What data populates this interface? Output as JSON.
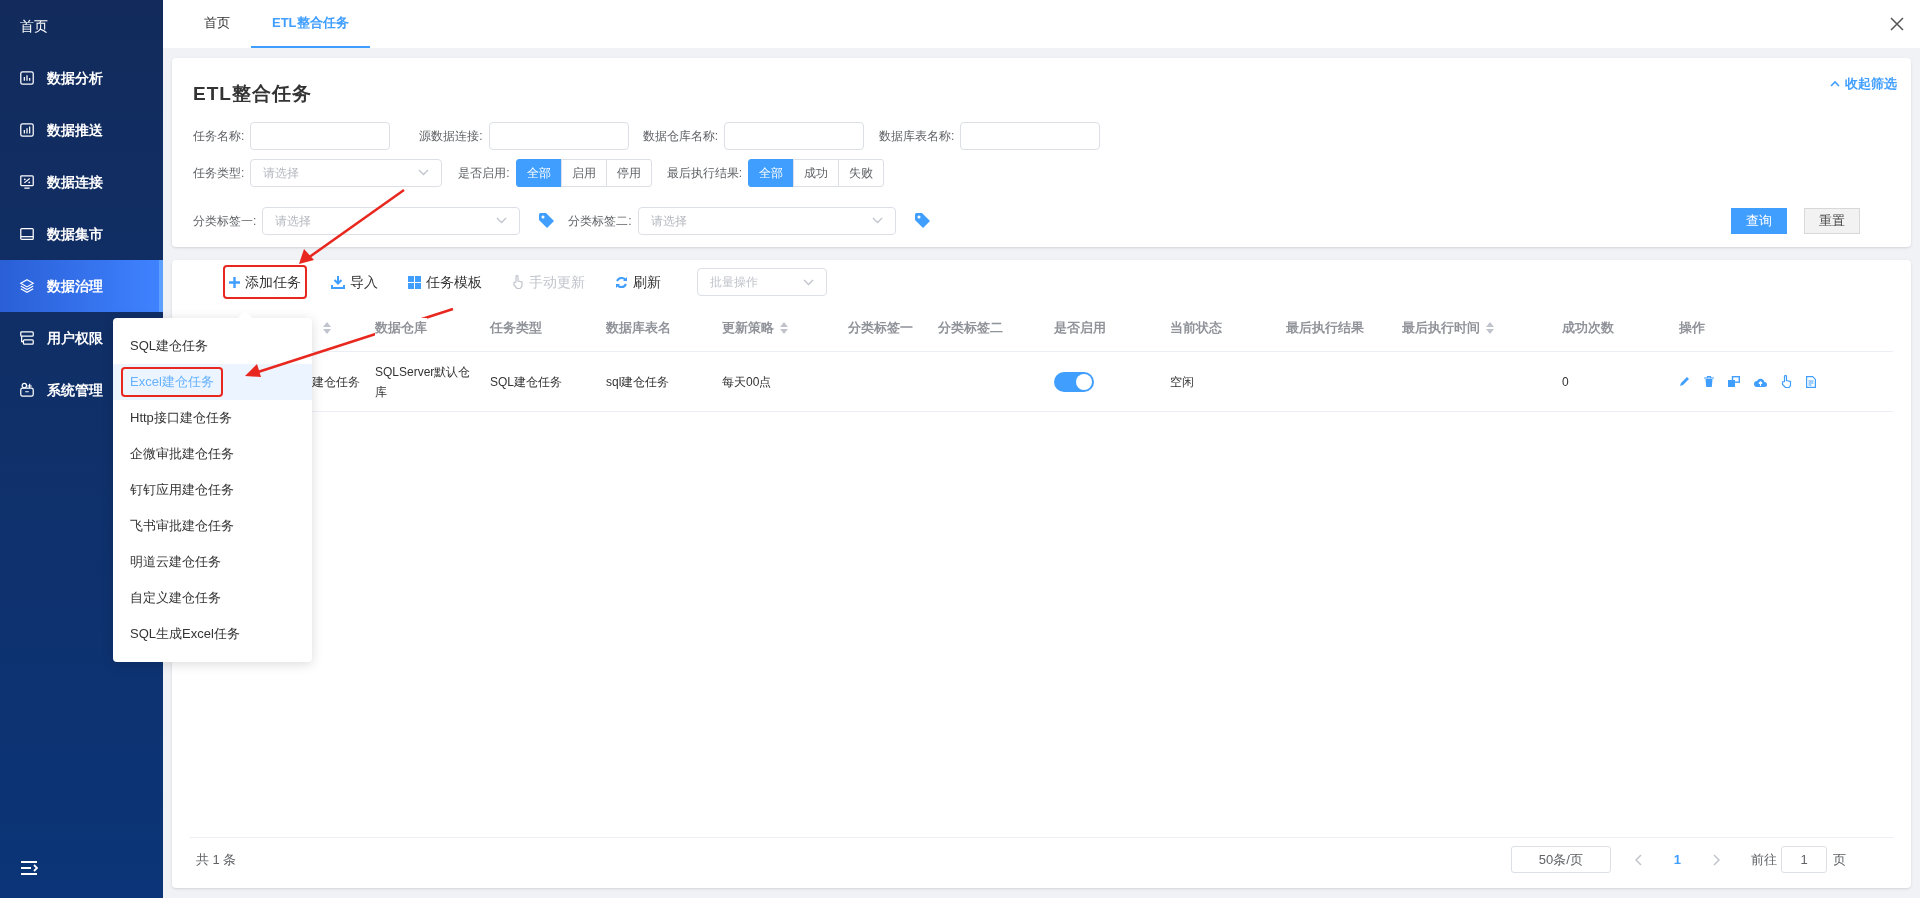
{
  "sidebar": {
    "items": [
      {
        "label": "首页",
        "selected": false
      },
      {
        "label": "数据分析",
        "selected": false
      },
      {
        "label": "数据推送",
        "selected": false
      },
      {
        "label": "数据连接",
        "selected": false
      },
      {
        "label": "数据集市",
        "selected": false
      },
      {
        "label": "数据治理",
        "selected": true
      },
      {
        "label": "用户权限",
        "selected": false
      },
      {
        "label": "系统管理",
        "selected": false
      }
    ]
  },
  "tabs": [
    {
      "label": "首页",
      "selected": false
    },
    {
      "label": "ETL整合任务",
      "selected": true
    }
  ],
  "filter_panel": {
    "title": "ETL整合任务",
    "collapse_link": "收起筛选",
    "text_fields": [
      {
        "label": "任务名称:"
      },
      {
        "label": "源数据连接:"
      },
      {
        "label": "数据仓库名称:"
      },
      {
        "label": "数据库表名称:"
      }
    ],
    "task_type": {
      "label": "任务类型:",
      "placeholder": "请选择"
    },
    "enabled_filter": {
      "label": "是否启用:",
      "options": [
        {
          "label": "全部",
          "selected": true
        },
        {
          "label": "启用",
          "selected": false
        },
        {
          "label": "停用",
          "selected": false
        }
      ]
    },
    "result_filter": {
      "label": "最后执行结果:",
      "options": [
        {
          "label": "全部",
          "selected": true
        },
        {
          "label": "成功",
          "selected": false
        },
        {
          "label": "失败",
          "selected": false
        }
      ]
    },
    "tag_filters": [
      {
        "label": "分类标签一:",
        "placeholder": "请选择"
      },
      {
        "label": "分类标签二:",
        "placeholder": "请选择"
      }
    ],
    "query_button": "查询",
    "reset_button": "重置"
  },
  "toolbar": {
    "buttons": [
      {
        "label": "添加任务",
        "disabled": false,
        "marked": true
      },
      {
        "label": "导入",
        "disabled": false,
        "marked": false
      },
      {
        "label": "任务模板",
        "disabled": false,
        "marked": false
      },
      {
        "label": "手动更新",
        "disabled": true,
        "marked": false
      },
      {
        "label": "刷新",
        "disabled": false,
        "marked": false
      }
    ],
    "batch_select": {
      "placeholder": "批量操作"
    }
  },
  "add_menu": {
    "items": [
      {
        "label": "SQL建仓任务",
        "selected": false,
        "marked": false
      },
      {
        "label": "Excel建仓任务",
        "selected": true,
        "marked": true
      },
      {
        "label": "Http接口建仓任务",
        "selected": false,
        "marked": false
      },
      {
        "label": "企微审批建仓任务",
        "selected": false,
        "marked": false
      },
      {
        "label": "钉钉应用建仓任务",
        "selected": false,
        "marked": false
      },
      {
        "label": "飞书审批建仓任务",
        "selected": false,
        "marked": false
      },
      {
        "label": "明道云建仓任务",
        "selected": false,
        "marked": false
      },
      {
        "label": "自定义建仓任务",
        "selected": false,
        "marked": false
      },
      {
        "label": "SQL生成Excel任务",
        "selected": false,
        "marked": false
      }
    ]
  },
  "table": {
    "columns": [
      {
        "sortable": true
      },
      {
        "label": "数据仓库",
        "sortable": false
      },
      {
        "label": "任务类型",
        "sortable": false
      },
      {
        "label": "数据库表名",
        "sortable": false
      },
      {
        "label": "更新策略",
        "sortable": true
      },
      {
        "label": "分类标签一",
        "sortable": false
      },
      {
        "label": "分类标签二",
        "sortable": false
      },
      {
        "label": "是否启用",
        "sortable": false
      },
      {
        "label": "当前状态",
        "sortable": false
      },
      {
        "label": "最后执行结果",
        "sortable": false
      },
      {
        "label": "最后执行时间",
        "sortable": true
      },
      {
        "label": "成功次数",
        "sortable": false
      },
      {
        "label": "操作",
        "sortable": false
      }
    ],
    "rows": [
      {
        "column_1": "建仓任务",
        "warehouse": "SQLServer默认仓库",
        "task_type": "SQL建仓任务",
        "table_name": "sql建仓任务",
        "update_policy": "每天00点",
        "enabled": true,
        "status": "空闲",
        "success_count": "0"
      }
    ]
  },
  "pagination": {
    "total": "共 1 条",
    "page_size": "50条/页",
    "current_page": "1",
    "goto_label": "前往",
    "goto_value": "1",
    "page_suffix": "页"
  }
}
